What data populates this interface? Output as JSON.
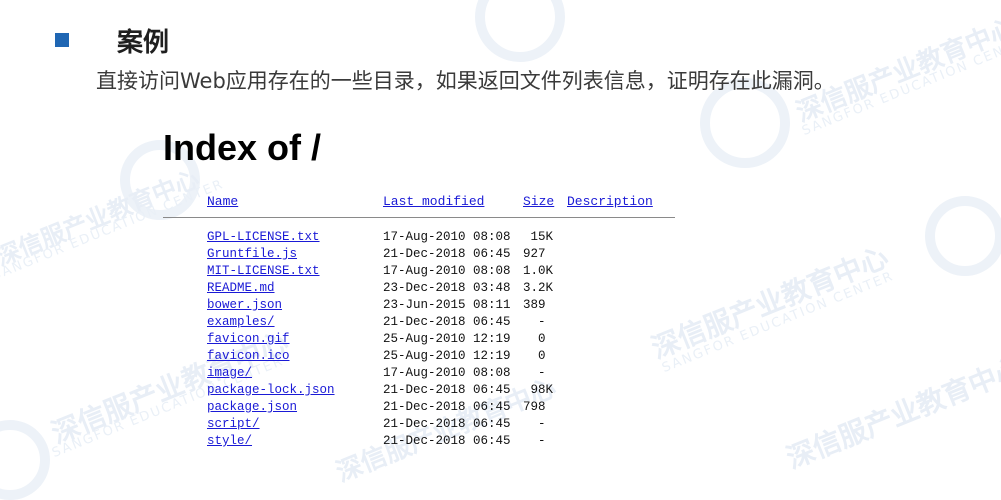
{
  "section": {
    "title": "案例",
    "description": "直接访问Web应用存在的一些目录，如果返回文件列表信息，证明存在此漏洞。"
  },
  "listing": {
    "title": "Index of /",
    "columns": {
      "name": "Name",
      "last_modified": "Last modified",
      "size": "Size",
      "description": "Description"
    },
    "rows": [
      {
        "name": "GPL-LICENSE.txt",
        "modified": "17-Aug-2010 08:08",
        "size": " 15K"
      },
      {
        "name": "Gruntfile.js",
        "modified": "21-Dec-2018 06:45",
        "size": "927"
      },
      {
        "name": "MIT-LICENSE.txt",
        "modified": "17-Aug-2010 08:08",
        "size": "1.0K"
      },
      {
        "name": "README.md",
        "modified": "23-Dec-2018 03:48",
        "size": "3.2K"
      },
      {
        "name": "bower.json",
        "modified": "23-Jun-2015 08:11",
        "size": "389"
      },
      {
        "name": "examples/",
        "modified": "21-Dec-2018 06:45",
        "size": "  -"
      },
      {
        "name": "favicon.gif",
        "modified": "25-Aug-2010 12:19",
        "size": "  0"
      },
      {
        "name": "favicon.ico",
        "modified": "25-Aug-2010 12:19",
        "size": "  0"
      },
      {
        "name": "image/",
        "modified": "17-Aug-2010 08:08",
        "size": "  -"
      },
      {
        "name": "package-lock.json",
        "modified": "21-Dec-2018 06:45",
        "size": " 98K"
      },
      {
        "name": "package.json",
        "modified": "21-Dec-2018 06:45",
        "size": "798"
      },
      {
        "name": "script/",
        "modified": "21-Dec-2018 06:45",
        "size": "  -"
      },
      {
        "name": "style/",
        "modified": "21-Dec-2018 06:45",
        "size": "  -"
      }
    ]
  },
  "watermark": {
    "text": "深信服产业教育中心",
    "sub": "SANGFOR EDUCATION CENTER"
  },
  "colors": {
    "bullet": "#1f66b3",
    "link": "#1a1ad6",
    "watermark": "#e8eef6"
  }
}
